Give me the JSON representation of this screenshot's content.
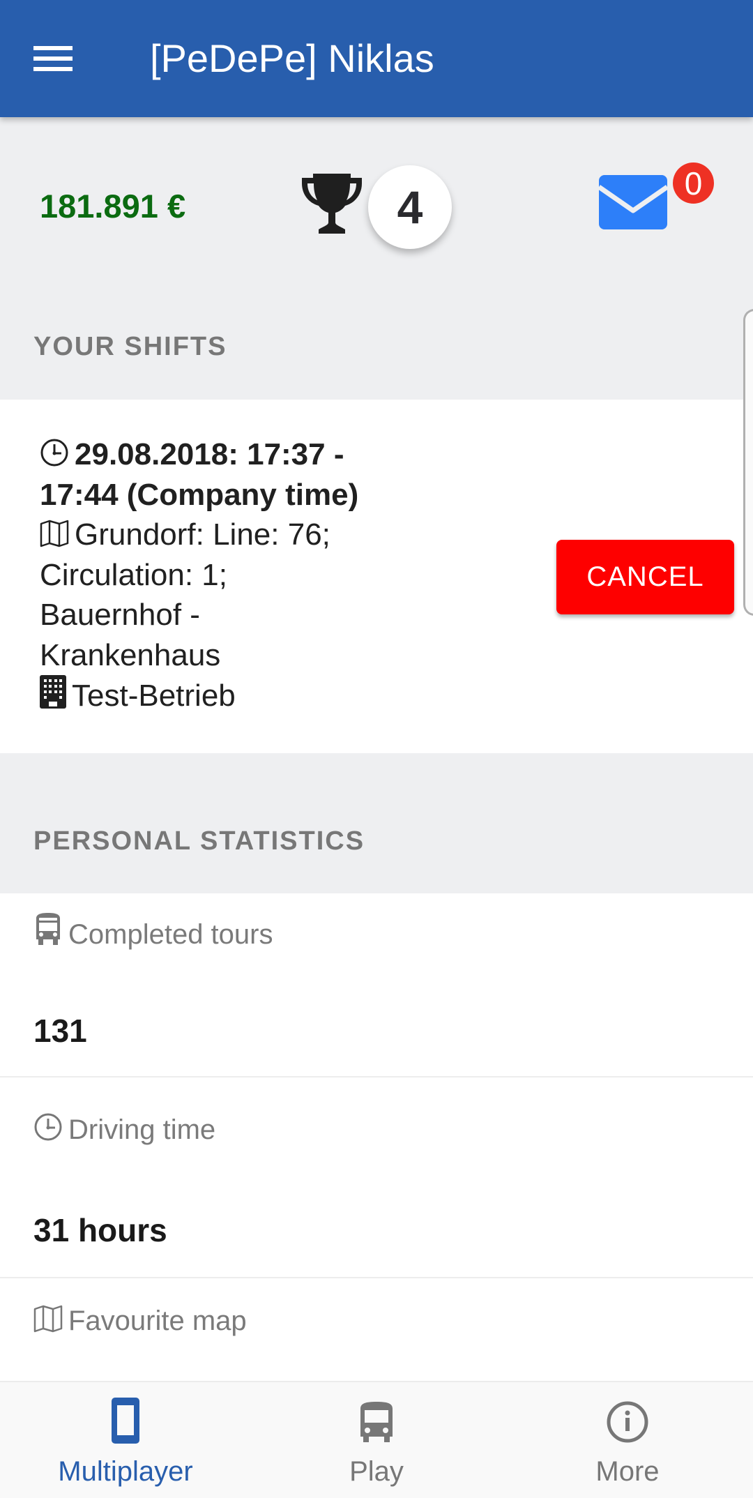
{
  "appbar": {
    "menu_icon": "hamburger-menu-icon",
    "title": "[PeDePe] Niklas"
  },
  "status": {
    "money": "181.891 €",
    "trophy_icon": "trophy-icon",
    "rank": "4",
    "mail_icon": "envelope-icon",
    "unread_messages": "0",
    "colors": {
      "money": "#0b6b11",
      "mail": "#2d7ff9",
      "badge": "#ee3124"
    }
  },
  "shifts": {
    "header": "YOUR SHIFTS",
    "items": [
      {
        "time_icon": "clock-icon",
        "time": "29.08.2018: 17:37 - 17:44 (Company time)",
        "time_line1": "29.08.2018: 17:37 -",
        "time_line2": "17:44 (Company time)",
        "map_icon": "map-icon",
        "route_line1": "Grundorf: Line: 76;",
        "route_line2": "Circulation: 1;",
        "route_line3": "Bauernhof -",
        "route_line4": "Krankenhaus",
        "company_icon": "building-icon",
        "company": "Test-Betrieb",
        "cancel_label": "CANCEL"
      }
    ]
  },
  "statistics": {
    "header": "PERSONAL STATISTICS",
    "items": [
      {
        "icon": "bus-icon",
        "label": "Completed tours",
        "value": "131"
      },
      {
        "icon": "clock-icon",
        "label": "Driving time",
        "value": "31 hours"
      },
      {
        "icon": "map-icon",
        "label": "Favourite map",
        "value": ""
      }
    ]
  },
  "bottom_nav": {
    "items": [
      {
        "icon": "smartphone-icon",
        "label": "Multiplayer",
        "active": true
      },
      {
        "icon": "bus-icon",
        "label": "Play",
        "active": false
      },
      {
        "icon": "info-icon",
        "label": "More",
        "active": false
      }
    ],
    "active_color": "#285ead"
  }
}
